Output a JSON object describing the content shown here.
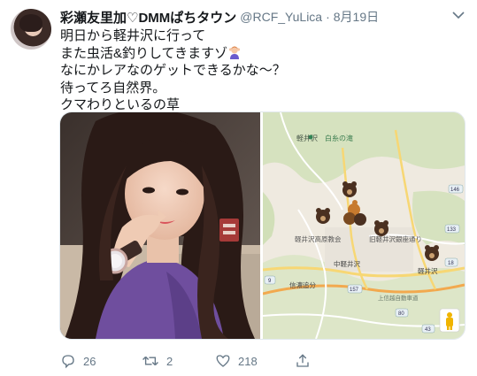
{
  "user": {
    "name": "彩瀬友里加♡DMMぱちタウン",
    "handle": "@RCF_YuLica",
    "separator": "·",
    "date": "8月19日"
  },
  "tweet": {
    "lines": [
      "明日から軽井沢に行って",
      "また虫活&釣りしてきますゾ",
      "なにかレアなのゲットできるかな〜？",
      "待ってろ自然界。",
      "クマわりといるの草"
    ],
    "emoji": "woman-gesturing-ok-emoji"
  },
  "map": {
    "labels": {
      "karuizawa": "軽井沢",
      "shiraito": "白糸の滝",
      "church": "軽井沢高原教会",
      "ginza": "旧軽井沢銀座通り",
      "naka_karuizawa": "中軽井沢",
      "shinano": "信濃追分",
      "karuizawa_station": "軽井沢",
      "road18": "18",
      "road146": "146",
      "road133": "133",
      "road9": "9",
      "road43": "43",
      "road157": "157",
      "road80": "80",
      "bypass": "上信越自動車道"
    },
    "pins": [
      "bear-icon",
      "bear-icon",
      "bear-group-icon",
      "bear-icon",
      "bear-icon"
    ],
    "colors": {
      "land": "#efeae0",
      "park": "#c9dcb0",
      "road": "#f7d774",
      "expressway": "#f2a94e"
    }
  },
  "actions": {
    "reply_count": "26",
    "retweet_count": "2",
    "like_count": "218"
  }
}
